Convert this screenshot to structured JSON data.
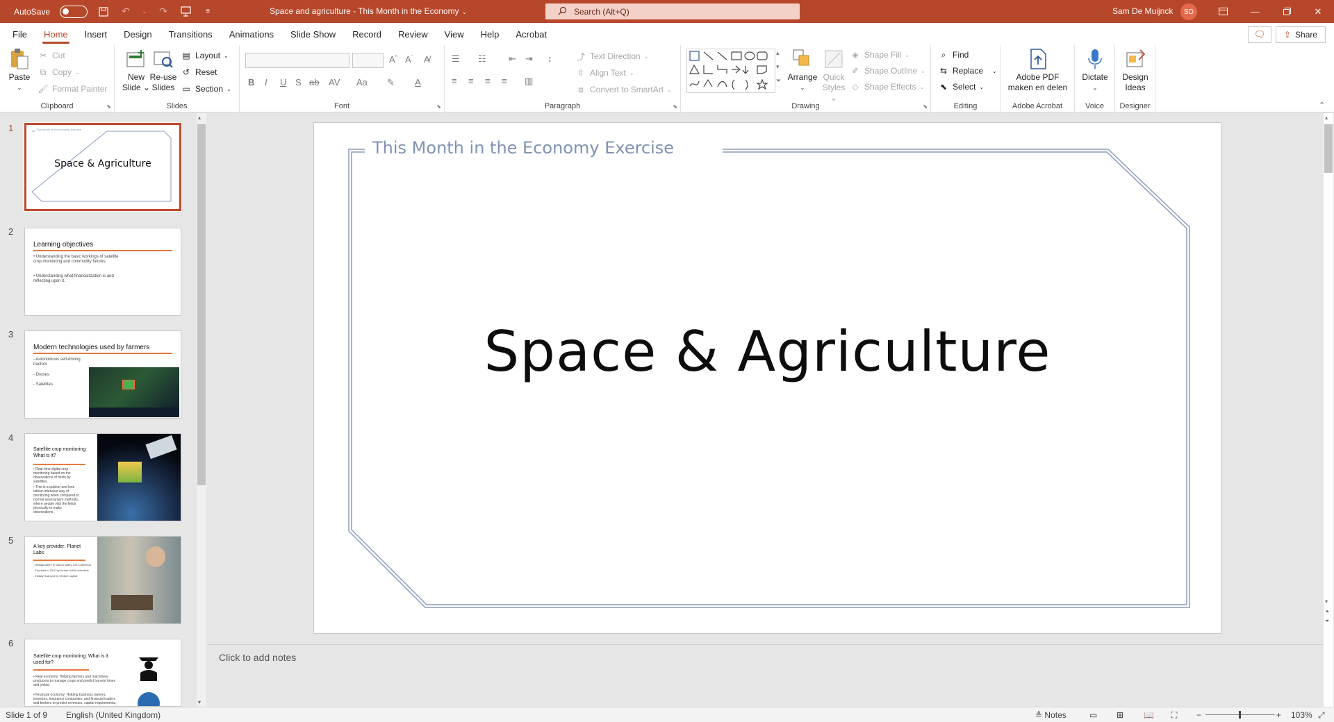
{
  "titlebar": {
    "autosave_label": "AutoSave",
    "autosave_state": "Off",
    "doc_title": "Space and agriculture - This Month in the Economy",
    "search_placeholder": "Search (Alt+Q)",
    "user_name": "Sam De Muijnck",
    "user_initials": "SD",
    "accent": "#b7472a"
  },
  "menu": {
    "tabs": [
      "File",
      "Home",
      "Insert",
      "Design",
      "Transitions",
      "Animations",
      "Slide Show",
      "Record",
      "Review",
      "View",
      "Help",
      "Acrobat"
    ],
    "active": "Home",
    "share_label": "Share"
  },
  "ribbon": {
    "clipboard": {
      "label": "Clipboard",
      "paste": "Paste",
      "cut": "Cut",
      "copy": "Copy",
      "format_painter": "Format Painter"
    },
    "slides": {
      "label": "Slides",
      "new_slide": "New Slide",
      "reuse_slides": "Re-use Slides",
      "layout": "Layout",
      "reset": "Reset",
      "section": "Section"
    },
    "font": {
      "label": "Font"
    },
    "paragraph": {
      "label": "Paragraph",
      "text_direction": "Text Direction",
      "align_text": "Align Text",
      "convert_smartart": "Convert to SmartArt"
    },
    "drawing": {
      "label": "Drawing",
      "arrange": "Arrange",
      "quick_styles": "Quick Styles",
      "shape_fill": "Shape Fill",
      "shape_outline": "Shape Outline",
      "shape_effects": "Shape Effects"
    },
    "editing": {
      "label": "Editing",
      "find": "Find",
      "replace": "Replace",
      "select": "Select"
    },
    "acrobat": {
      "label": "Adobe Acrobat",
      "btn_line1": "Adobe PDF",
      "btn_line2": "maken en delen"
    },
    "voice": {
      "label": "Voice",
      "dictate": "Dictate"
    },
    "designer": {
      "label": "Designer",
      "design_line1": "Design",
      "design_line2": "Ideas"
    }
  },
  "slides": [
    {
      "num": "1",
      "title": "Space & Agriculture",
      "header": "This Month in the Economy Exercise"
    },
    {
      "num": "2",
      "title": "Learning objectives",
      "bullets": [
        "• Understanding the basic workings of satellite crop monitoring and commodity futures.",
        "• Understanding what financialization is and reflecting upon it."
      ]
    },
    {
      "num": "3",
      "title": "Modern technologies used by farmers",
      "bullets": [
        "- Autonomous self-driving tractors",
        "- Drones",
        "- Satellites"
      ]
    },
    {
      "num": "4",
      "title": "Satellite crop monitoring: What is it?",
      "bullets": [
        "• Real-time digital crop monitoring based on the observations of fields by satellites.",
        "• This is a quicker and less labour-intensive way of monitoring when compared to normal assessment methods, where people visit the fields physically to make observations."
      ]
    },
    {
      "num": "5",
      "title": "A key provider: Planet Labs",
      "bullets": [
        "- Headquarters in Silicon Valley (US California)",
        "- Founded in 2010 by former NASA scientists",
        "- Initially financed by venture capital"
      ]
    },
    {
      "num": "6",
      "title": "Satellite crop monitoring: What is it used for?",
      "bullets": [
        "• Real economy: Helping farmers and machinery producers to manage crops and predict harvest times and yields.",
        "• Financial economy: Helping business owners, investors, insurance companies, and financial traders and brokers to predict revenues, capital requirements, risk assessments, and"
      ]
    }
  ],
  "main_slide": {
    "header": "This Month in the Economy Exercise",
    "title": "Space & Agriculture"
  },
  "notes_placeholder": "Click to add notes",
  "status": {
    "slide_info": "Slide 1 of 9",
    "language": "English (United Kingdom)",
    "notes": "Notes",
    "zoom": "103%"
  }
}
